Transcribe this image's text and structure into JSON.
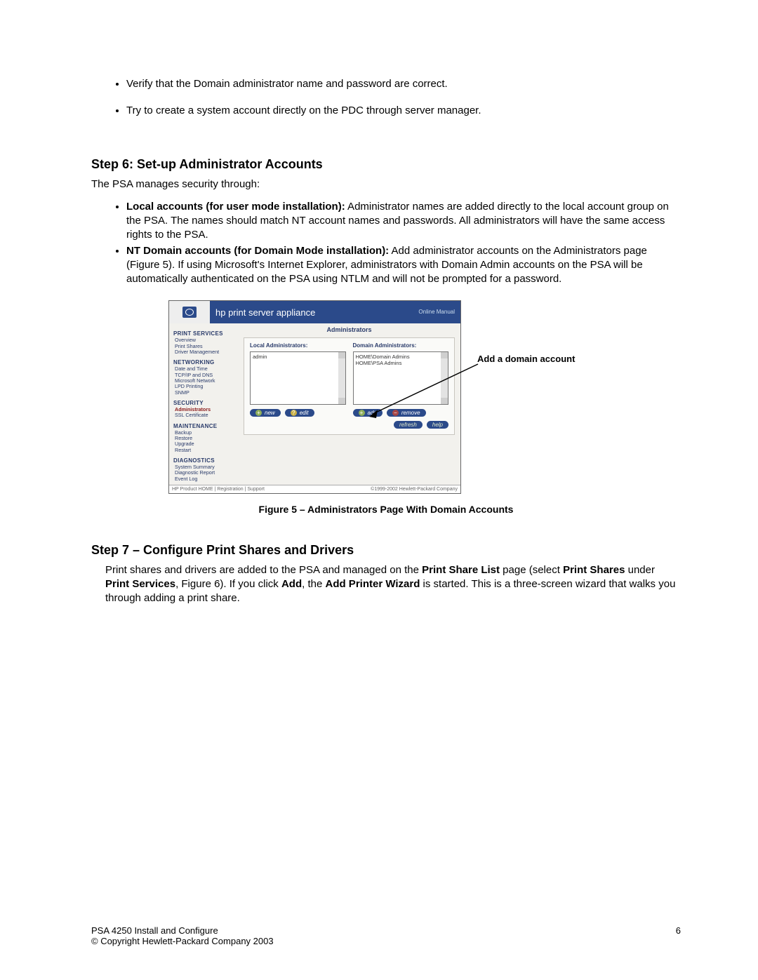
{
  "bullets_top": [
    "Verify that the Domain administrator name and password are correct.",
    "Try to create a system account directly on the PDC through server manager."
  ],
  "step6": {
    "heading": "Step 6: Set-up Administrator Accounts",
    "intro": "The PSA manages security through:",
    "items": [
      {
        "lead": "Local accounts (for user mode installation):",
        "rest": "  Administrator names are added directly to the local account group on the PSA.  The names should match NT account names and passwords.  All administrators will have the same access rights to the PSA."
      },
      {
        "lead": "NT Domain accounts (for Domain Mode installation):",
        "rest": "  Add administrator accounts on the Administrators page (Figure 5).  If using Microsoft's Internet Explorer, administrators with Domain Admin accounts on the PSA will be automatically authenticated on the PSA using NTLM and will not be prompted for a password."
      }
    ]
  },
  "figure": {
    "annotation": "Add a domain account",
    "caption": "Figure 5 – Administrators Page With Domain Accounts",
    "shot": {
      "title": "hp print server appliance",
      "online": "Online\nManual",
      "sidebar": [
        {
          "group": "PRINT SERVICES",
          "items": [
            "Overview",
            "Print Shares",
            "Driver Management"
          ]
        },
        {
          "group": "NETWORKING",
          "items": [
            "Date and Time",
            "TCP/IP and DNS",
            "Microsoft Network",
            "LPD Printing",
            "SNMP"
          ]
        },
        {
          "group": "SECURITY",
          "items": [
            "Administrators",
            "SSL Certificate"
          ],
          "selectedIndex": 0
        },
        {
          "group": "MAINTENANCE",
          "items": [
            "Backup",
            "Restore",
            "Upgrade",
            "Restart"
          ]
        },
        {
          "group": "DIAGNOSTICS",
          "items": [
            "System Summary",
            "Diagnostic Report",
            "Event Log"
          ]
        }
      ],
      "main": {
        "title": "Administrators",
        "localLabel": "Local Administrators:",
        "domainLabel": "Domain Administrators:",
        "localList": [
          "admin"
        ],
        "domainList": [
          "HOME\\Domain Admins",
          "HOME\\PSA Admins"
        ],
        "btnNew": "new",
        "btnEdit": "edit",
        "btnAdd": "add",
        "btnRemove": "remove",
        "btnRefresh": "refresh",
        "btnHelp": "help"
      },
      "footerLeft": "HP Product HOME   |   Registration   |   Support",
      "footerRight": "©1999-2002 Hewlett-Packard Company"
    }
  },
  "step7": {
    "heading": "Step 7 – Configure Print Shares and Drivers",
    "p1a": "Print shares and drivers are added to the PSA and managed on the ",
    "p1b": "Print Share List",
    "p1c": " page (select ",
    "p1d": "Print Shares",
    "p1e": " under ",
    "p1f": "Print Services",
    "p1g": ", Figure 6).  If you click ",
    "p1h": "Add",
    "p1i": ", the ",
    "p1j": "Add Printer Wizard",
    "p1k": " is started.  This is a three-screen wizard that walks you through adding a print share."
  },
  "footer": {
    "left1": "PSA 4250 Install and Configure",
    "left2": "© Copyright Hewlett-Packard Company 2003",
    "pageNum": "6"
  }
}
